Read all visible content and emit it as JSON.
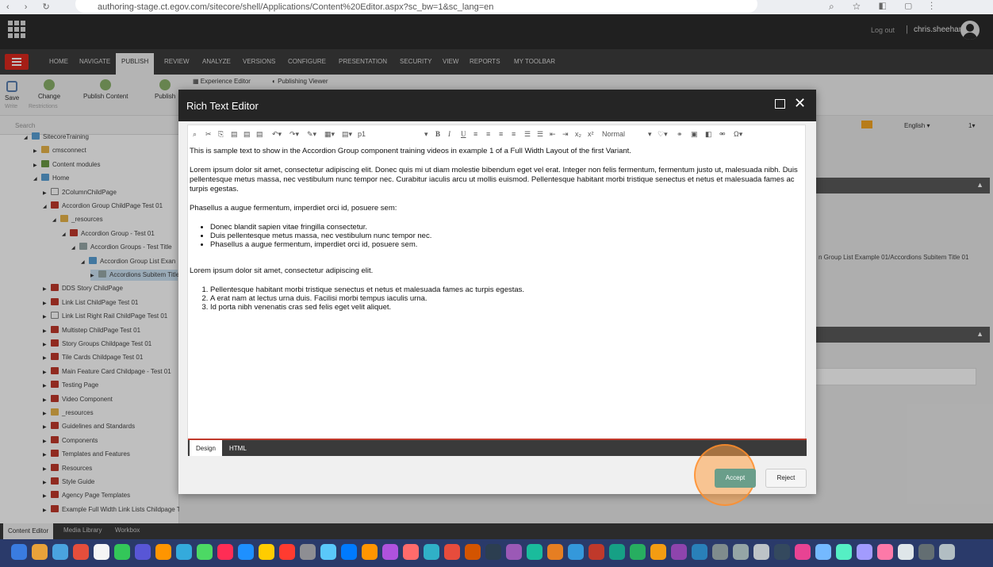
{
  "browser": {
    "url": "authoring-stage.ct.egov.com/sitecore/shell/Applications/Content%20Editor.aspx?sc_bw=1&sc_lang=en"
  },
  "topbar": {
    "logout": "Log out",
    "separator": "|",
    "username": "chris.sheehan2"
  },
  "ribbon_tabs": [
    "HOME",
    "NAVIGATE",
    "PUBLISH",
    "REVIEW",
    "ANALYZE",
    "VERSIONS",
    "CONFIGURE",
    "PRESENTATION",
    "SECURITY",
    "VIEW",
    "REPORTS",
    "MY TOOLBAR"
  ],
  "active_tab": "PUBLISH",
  "ribbon": {
    "save": "Save",
    "change": "Change",
    "publish_content": "Publish Content",
    "publish": "Publish",
    "experience_editor": "Experience Editor",
    "publishing_viewer": "Publishing Viewer",
    "write": "Write",
    "restrictions": "Restrictions"
  },
  "search_placeholder": "Search",
  "tree": [
    {
      "label": "SitecoreTraining",
      "icon": "blu",
      "level": 0
    },
    {
      "label": "cmsconnect",
      "icon": "yel",
      "level": 1
    },
    {
      "label": "Content modules",
      "icon": "grn",
      "level": 1
    },
    {
      "label": "Home",
      "icon": "blu",
      "level": 1
    },
    {
      "label": "2ColumnChildPage",
      "icon": "pg",
      "level": 2
    },
    {
      "label": "Accordion Group ChildPage Test 01",
      "icon": "red",
      "level": 2
    },
    {
      "label": "_resources",
      "icon": "yel",
      "level": 3
    },
    {
      "label": "Accordion Group - Test 01",
      "icon": "red",
      "level": 4
    },
    {
      "label": "Accordion Groups - Test Title",
      "icon": "gr",
      "level": 5
    },
    {
      "label": "Accordion Group List Exan",
      "icon": "blu",
      "level": 6
    },
    {
      "label": "Accordions Subitem Title",
      "icon": "gr",
      "level": 7
    },
    {
      "label": "DDS Story ChildPage",
      "icon": "red",
      "level": 2
    },
    {
      "label": "Link List ChildPage Test 01",
      "icon": "red",
      "level": 2
    },
    {
      "label": "Link List Right Rail ChildPage Test 01",
      "icon": "pg",
      "level": 2
    },
    {
      "label": "Multistep ChildPage Test 01",
      "icon": "red",
      "level": 2
    },
    {
      "label": "Story Groups Childpage Test 01",
      "icon": "red",
      "level": 2
    },
    {
      "label": "Tile Cards Childpage Test 01",
      "icon": "red",
      "level": 2
    },
    {
      "label": "Main Feature Card Childpage - Test 01",
      "icon": "red",
      "level": 2
    },
    {
      "label": "Testing Page",
      "icon": "red",
      "level": 2
    },
    {
      "label": "Video Component",
      "icon": "red",
      "level": 2
    },
    {
      "label": "_resources",
      "icon": "yel",
      "level": 2
    },
    {
      "label": "Guidelines and Standards",
      "icon": "red",
      "level": 2
    },
    {
      "label": "Components",
      "icon": "red",
      "level": 2
    },
    {
      "label": "Templates and Features",
      "icon": "red",
      "level": 2
    },
    {
      "label": "Resources",
      "icon": "red",
      "level": 2
    },
    {
      "label": "Style Guide",
      "icon": "red",
      "level": 2
    },
    {
      "label": "Agency Page Templates",
      "icon": "red",
      "level": 2
    },
    {
      "label": "Example Full Width Link Lists Childpage Test 01",
      "icon": "red",
      "level": 2
    }
  ],
  "right": {
    "path": "n Group List Example 01/Accordions Subitem Title 01",
    "language": "English"
  },
  "bottom_tabs": [
    "Content Editor",
    "Media Library",
    "Workbox"
  ],
  "modal": {
    "title": "Rich Text Editor",
    "format_placeholder": "p1",
    "style_select": "Normal",
    "intro": "This is sample text to show in the Accordion Group component training videos in example 1 of a Full Width Layout of the first Variant.",
    "para1": "Lorem ipsum dolor sit amet, consectetur adipiscing elit. Donec quis mi ut diam molestie bibendum eget vel erat. Integer non felis fermentum, fermentum justo ut, malesuada nibh. Duis pellentesque metus massa, nec vestibulum nunc tempor nec. Curabitur iaculis arcu ut mollis euismod. Pellentesque habitant morbi tristique senectus et netus et malesuada fames ac turpis egestas.",
    "para2": "Phasellus a augue fermentum, imperdiet orci id, posuere sem:",
    "bullets": [
      "Donec blandit sapien vitae fringilla consectetur.",
      "Duis pellentesque metus massa, nec vestibulum nunc tempor nec.",
      "Phasellus a augue fermentum, imperdiet orci id, posuere sem."
    ],
    "para3": "Lorem ipsum dolor sit amet, consectetur adipiscing elit.",
    "numbered": [
      "Pellentesque habitant morbi tristique senectus et netus et malesuada fames ac turpis egestas.",
      "A erat nam at lectus urna duis. Facilisi morbi tempus iaculis urna.",
      "Id porta nibh venenatis cras sed felis eget velit aliquet."
    ],
    "tab_design": "Design",
    "tab_html": "HTML",
    "accept": "Accept",
    "reject": "Reject"
  },
  "colors": {
    "accent": "#dc291e",
    "accept": "#6a9e8a",
    "dock": "#2a3a6a"
  }
}
